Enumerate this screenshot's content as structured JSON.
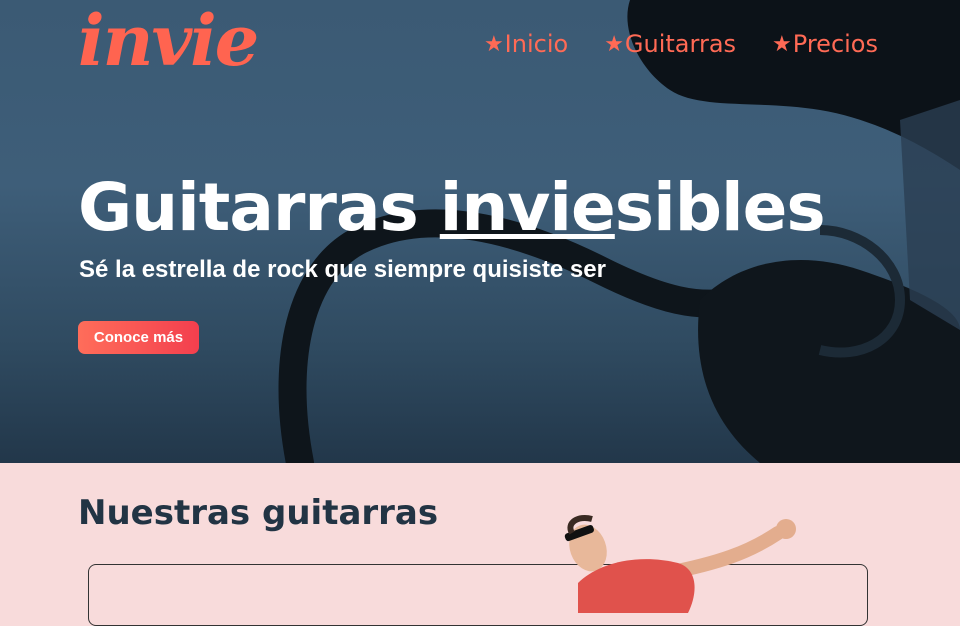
{
  "brand": {
    "logo": "invie"
  },
  "nav": {
    "items": [
      {
        "label": "Inicio"
      },
      {
        "label": "Guitarras"
      },
      {
        "label": "Precios"
      }
    ]
  },
  "hero": {
    "title_pre": "Guitarras ",
    "title_highlight": "invie",
    "title_post": "sibles",
    "subtitle": "Sé la estrella de rock que siempre quisiste ser",
    "cta_label": "Conoce más"
  },
  "section": {
    "title": "Nuestras guitarras"
  },
  "colors": {
    "accent": "#ff6450",
    "hero_bg": "#3e5e79",
    "section_bg": "#f8dbdb",
    "heading": "#223444"
  }
}
